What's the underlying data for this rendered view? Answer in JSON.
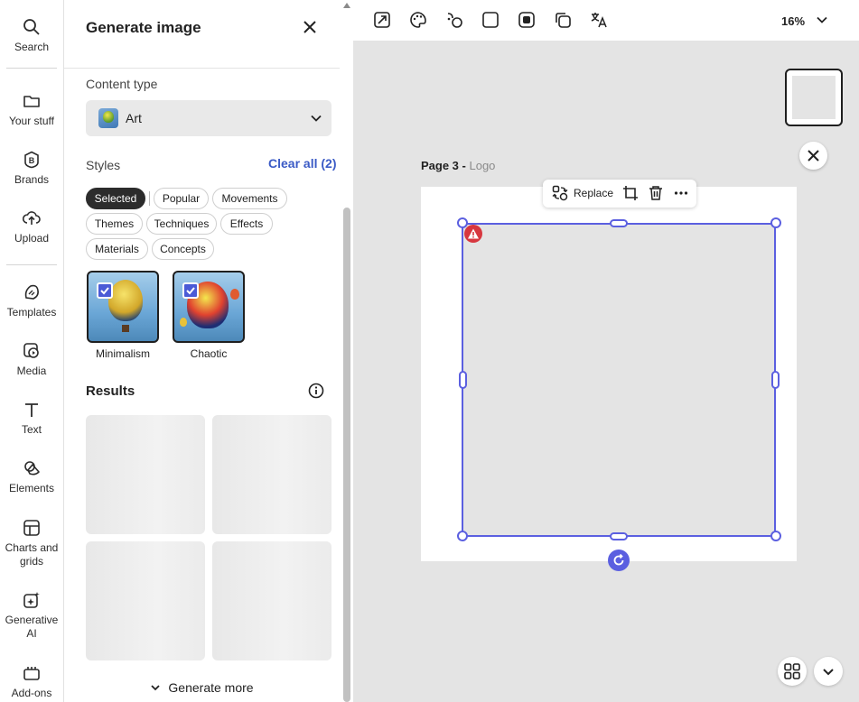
{
  "rail": {
    "items": [
      {
        "label": "Search",
        "icon": "search-icon"
      },
      {
        "label": "Your stuff",
        "icon": "folder-icon"
      },
      {
        "label": "Brands",
        "icon": "brand-icon"
      },
      {
        "label": "Upload",
        "icon": "upload-icon"
      },
      {
        "label": "Templates",
        "icon": "templates-icon"
      },
      {
        "label": "Media",
        "icon": "media-icon"
      },
      {
        "label": "Text",
        "icon": "text-icon"
      },
      {
        "label": "Elements",
        "icon": "elements-icon"
      },
      {
        "label": "Charts and grids",
        "icon": "charts-icon"
      },
      {
        "label": "Generative AI",
        "icon": "sparkle-icon"
      },
      {
        "label": "Add-ons",
        "icon": "addons-icon"
      }
    ]
  },
  "panel": {
    "title": "Generate image",
    "content_type_label": "Content type",
    "content_type_value": "Art",
    "styles_label": "Styles",
    "clear_all": "Clear all (2)",
    "chips": [
      "Selected",
      "Popular",
      "Movements",
      "Themes",
      "Techniques",
      "Effects",
      "Materials",
      "Concepts"
    ],
    "selected_styles": [
      "Minimalism",
      "Chaotic"
    ],
    "results_label": "Results",
    "generate_more": "Generate more"
  },
  "toolbar": {
    "zoom": "16%"
  },
  "canvas": {
    "page_label": "Page 3 -",
    "page_sub": "Logo",
    "float_replace": "Replace"
  },
  "colors": {
    "accent": "#5b5fe0",
    "link": "#3b5bc6",
    "warning": "#d7373f"
  }
}
